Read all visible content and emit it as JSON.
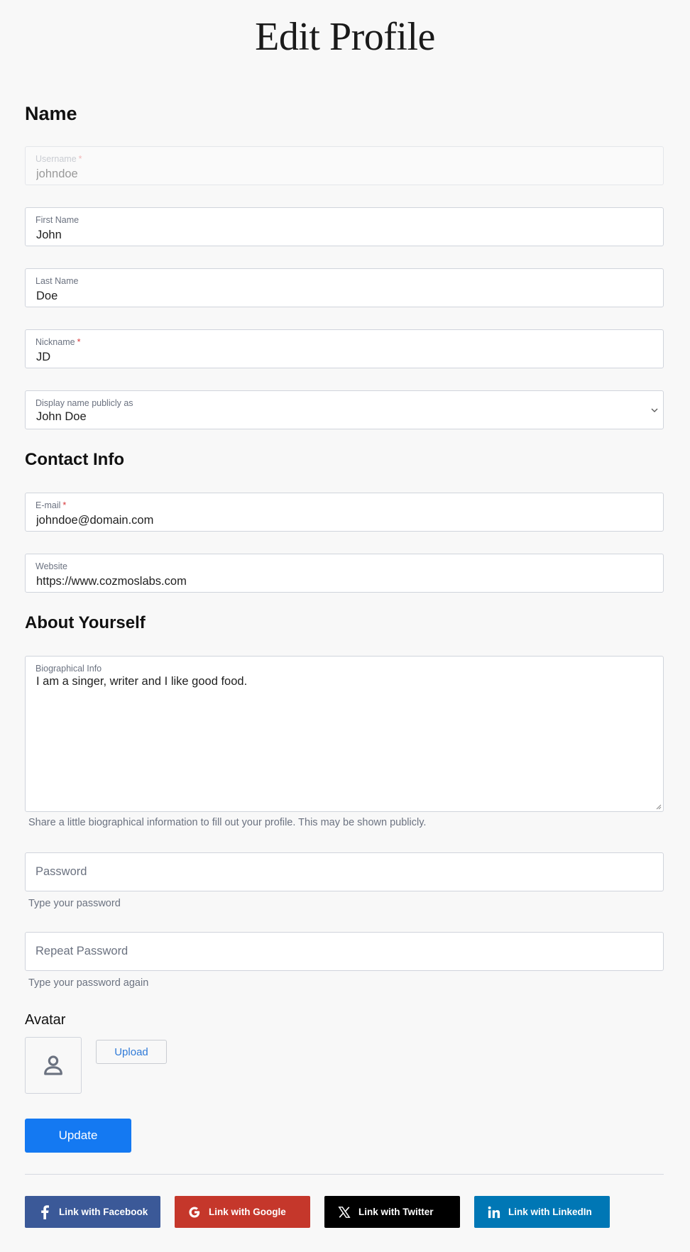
{
  "page": {
    "title": "Edit Profile"
  },
  "sections": {
    "name": "Name",
    "contact": "Contact Info",
    "about": "About Yourself"
  },
  "fields": {
    "username": {
      "label": "Username",
      "required": "*",
      "value": "johndoe",
      "disabled": true
    },
    "first_name": {
      "label": "First Name",
      "value": "John"
    },
    "last_name": {
      "label": "Last Name",
      "value": "Doe"
    },
    "nickname": {
      "label": "Nickname",
      "required": "*",
      "value": "JD"
    },
    "display_name": {
      "label": "Display name publicly as",
      "value": "John Doe"
    },
    "email": {
      "label": "E-mail",
      "required": "*",
      "value": "johndoe@domain.com"
    },
    "website": {
      "label": "Website",
      "value": "https://www.cozmoslabs.com"
    },
    "bio": {
      "label": "Biographical Info",
      "value": "I am a singer, writer and I like good food.",
      "hint": "Share a little biographical information to fill out your profile. This may be shown publicly."
    },
    "password": {
      "placeholder": "Password",
      "hint": "Type your password"
    },
    "repeat_password": {
      "placeholder": "Repeat Password",
      "hint": "Type your password again"
    }
  },
  "avatar": {
    "label": "Avatar",
    "icon": "user-icon",
    "upload_label": "Upload"
  },
  "actions": {
    "update_label": "Update"
  },
  "social": [
    {
      "label": "Link with Facebook",
      "icon": "facebook-icon",
      "color": "#3b5998"
    },
    {
      "label": "Link with Google",
      "icon": "google-icon",
      "color": "#c5372b"
    },
    {
      "label": "Link with Twitter",
      "icon": "x-twitter-icon",
      "color": "#000000"
    },
    {
      "label": "Link with LinkedIn",
      "icon": "linkedin-icon",
      "color": "#0077b5"
    }
  ]
}
